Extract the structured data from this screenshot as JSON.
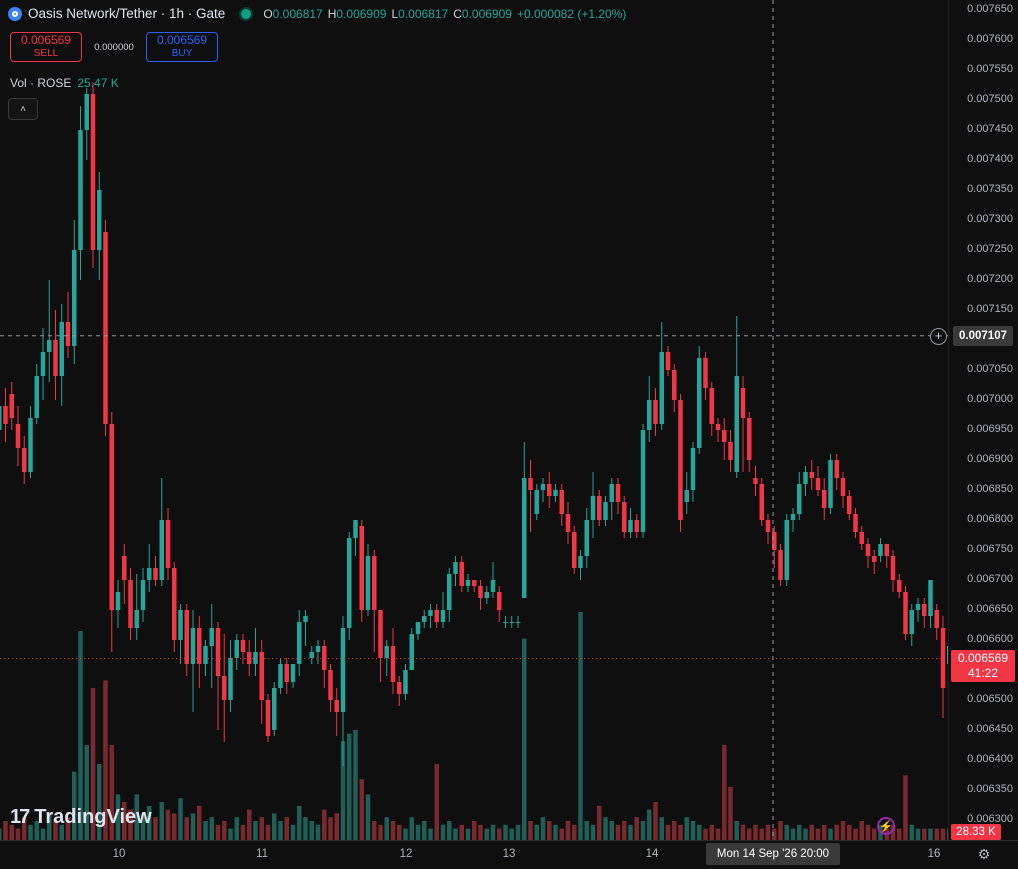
{
  "header": {
    "title": "Oasis Network/Tether · 1h · Gate",
    "ohlc": {
      "o_key": "O",
      "o": "0.006817",
      "h_key": "H",
      "h": "0.006909",
      "l_key": "L",
      "l": "0.006817",
      "c_key": "C",
      "c": "0.006909",
      "change": "+0.000082 (+1.20%)"
    }
  },
  "trade": {
    "sell_price": "0.006569",
    "sell_label": "SELL",
    "spread": "0.000000",
    "buy_price": "0.006569",
    "buy_label": "BUY"
  },
  "volume_indicator": {
    "label": "Vol · ROSE",
    "value": "25.47 K"
  },
  "branding": {
    "logo_text": "TradingView",
    "logo_mark": "17"
  },
  "price_axis": {
    "ticks": [
      "0.007650",
      "0.007600",
      "0.007550",
      "0.007500",
      "0.007450",
      "0.007400",
      "0.007350",
      "0.007300",
      "0.007250",
      "0.007200",
      "0.007150",
      "0.007100",
      "0.007050",
      "0.007000",
      "0.006950",
      "0.006900",
      "0.006850",
      "0.006800",
      "0.006750",
      "0.006700",
      "0.006650",
      "0.006600",
      "0.006550",
      "0.006500",
      "0.006450",
      "0.006400",
      "0.006350",
      "0.006300"
    ],
    "crosshair_price": "0.007107",
    "last_price": "0.006569",
    "countdown": "41:22",
    "volume_last": "28.33 K"
  },
  "time_axis": {
    "labels": [
      "10",
      "11",
      "12",
      "13",
      "14",
      "16"
    ],
    "crosshair_time": "Mon 14 Sep '26   20:00"
  },
  "colors": {
    "up": "#26a69a",
    "down": "#f23645",
    "up_vol": "#1e5f58",
    "down_vol": "#7a2a2f"
  },
  "chart_data": {
    "type": "candlestick",
    "x_labels": [
      "10",
      "11",
      "12",
      "13",
      "14",
      "16"
    ],
    "ylim": [
      0.00628,
      0.00766
    ],
    "candles": [
      [
        0.00695,
        0.00699,
        0.00693,
        0.00701
      ],
      [
        0.00699,
        0.00696,
        0.00693,
        0.00702
      ],
      [
        0.00701,
        0.00697,
        0.00695,
        0.00703
      ],
      [
        0.00696,
        0.00692,
        0.00689,
        0.00699
      ],
      [
        0.00692,
        0.00688,
        0.00686,
        0.00694
      ],
      [
        0.00688,
        0.00697,
        0.00687,
        0.00699
      ],
      [
        0.00697,
        0.00704,
        0.00696,
        0.00706
      ],
      [
        0.00704,
        0.00708,
        0.007,
        0.00712
      ],
      [
        0.00708,
        0.0071,
        0.00703,
        0.0072
      ],
      [
        0.0071,
        0.00704,
        0.007,
        0.00715
      ],
      [
        0.00704,
        0.00713,
        0.00699,
        0.00716
      ],
      [
        0.00713,
        0.00709,
        0.00707,
        0.00718
      ],
      [
        0.00709,
        0.00725,
        0.00706,
        0.0073
      ],
      [
        0.00725,
        0.00745,
        0.0072,
        0.00749
      ],
      [
        0.00745,
        0.00751,
        0.0074,
        0.00752
      ],
      [
        0.00751,
        0.00725,
        0.00722,
        0.00753
      ],
      [
        0.00725,
        0.00735,
        0.0072,
        0.00738
      ],
      [
        0.00728,
        0.00696,
        0.00694,
        0.0073
      ],
      [
        0.00696,
        0.00665,
        0.00658,
        0.00698
      ],
      [
        0.00665,
        0.00668,
        0.00662,
        0.0067
      ],
      [
        0.00674,
        0.0067,
        0.00666,
        0.00676
      ],
      [
        0.0067,
        0.00662,
        0.0066,
        0.00672
      ],
      [
        0.00662,
        0.00665,
        0.0066,
        0.00671
      ],
      [
        0.00665,
        0.0067,
        0.00663,
        0.00672
      ],
      [
        0.0067,
        0.00672,
        0.00668,
        0.00676
      ],
      [
        0.00672,
        0.0067,
        0.00669,
        0.00674
      ],
      [
        0.0067,
        0.0068,
        0.00669,
        0.00687
      ],
      [
        0.0068,
        0.00672,
        0.0067,
        0.00682
      ],
      [
        0.00672,
        0.0066,
        0.00658,
        0.00673
      ],
      [
        0.0066,
        0.00665,
        0.00656,
        0.00666
      ],
      [
        0.00665,
        0.00656,
        0.00654,
        0.00666
      ],
      [
        0.00656,
        0.00662,
        0.00648,
        0.00665
      ],
      [
        0.00662,
        0.00656,
        0.00652,
        0.00664
      ],
      [
        0.00656,
        0.00659,
        0.00654,
        0.0066
      ],
      [
        0.00659,
        0.00662,
        0.00652,
        0.00666
      ],
      [
        0.00662,
        0.00654,
        0.00645,
        0.00663
      ],
      [
        0.00654,
        0.0065,
        0.00643,
        0.00661
      ],
      [
        0.0065,
        0.00657,
        0.00648,
        0.0066
      ],
      [
        0.00657,
        0.0066,
        0.00655,
        0.00661
      ],
      [
        0.0066,
        0.00658,
        0.00656,
        0.00661
      ],
      [
        0.00658,
        0.00656,
        0.00654,
        0.0066
      ],
      [
        0.00656,
        0.00658,
        0.00654,
        0.00662
      ],
      [
        0.00658,
        0.0065,
        0.00646,
        0.0066
      ],
      [
        0.0065,
        0.00644,
        0.00643,
        0.00651
      ],
      [
        0.00645,
        0.00652,
        0.00644,
        0.00653
      ],
      [
        0.00652,
        0.00656,
        0.00651,
        0.00657
      ],
      [
        0.00656,
        0.00653,
        0.00651,
        0.00657
      ],
      [
        0.00653,
        0.00656,
        0.00652,
        0.00656
      ],
      [
        0.00656,
        0.00663,
        0.00654,
        0.00665
      ],
      [
        0.00663,
        0.00664,
        0.00659,
        0.00665
      ],
      [
        0.00657,
        0.00658,
        0.00656,
        0.00659
      ],
      [
        0.00658,
        0.00659,
        0.00656,
        0.0066
      ],
      [
        0.00659,
        0.00655,
        0.00652,
        0.0066
      ],
      [
        0.00655,
        0.0065,
        0.00648,
        0.00656
      ],
      [
        0.0065,
        0.00648,
        0.00644,
        0.00652
      ],
      [
        0.00648,
        0.00662,
        0.00639,
        0.00664
      ],
      [
        0.00662,
        0.00677,
        0.0066,
        0.00678
      ],
      [
        0.00677,
        0.0068,
        0.00674,
        0.0068
      ],
      [
        0.00679,
        0.00665,
        0.00663,
        0.0068
      ],
      [
        0.00665,
        0.00674,
        0.00664,
        0.00676
      ],
      [
        0.00674,
        0.00665,
        0.00658,
        0.00675
      ],
      [
        0.00665,
        0.00657,
        0.00653,
        0.00665
      ],
      [
        0.00657,
        0.00659,
        0.00654,
        0.0066
      ],
      [
        0.00659,
        0.00653,
        0.00651,
        0.00662
      ],
      [
        0.00653,
        0.00651,
        0.00649,
        0.00654
      ],
      [
        0.00651,
        0.00655,
        0.0065,
        0.00656
      ],
      [
        0.00655,
        0.00661,
        0.00655,
        0.00662
      ],
      [
        0.00661,
        0.00663,
        0.0066,
        0.00663
      ],
      [
        0.00663,
        0.00664,
        0.00662,
        0.00665
      ],
      [
        0.00664,
        0.00665,
        0.00662,
        0.00666
      ],
      [
        0.00665,
        0.00663,
        0.00662,
        0.00666
      ],
      [
        0.00663,
        0.00665,
        0.00662,
        0.00668
      ],
      [
        0.00665,
        0.00671,
        0.00663,
        0.00672
      ],
      [
        0.00671,
        0.00673,
        0.00669,
        0.00674
      ],
      [
        0.00673,
        0.00669,
        0.00668,
        0.00674
      ],
      [
        0.00669,
        0.0067,
        0.00668,
        0.00671
      ],
      [
        0.0067,
        0.00669,
        0.00668,
        0.0067
      ],
      [
        0.00669,
        0.00667,
        0.00665,
        0.0067
      ],
      [
        0.00667,
        0.00668,
        0.00666,
        0.00669
      ],
      [
        0.00668,
        0.0067,
        0.00667,
        0.00673
      ],
      [
        0.00668,
        0.00665,
        0.00663,
        0.00669
      ],
      [
        0.00663,
        0.00663,
        0.00662,
        0.00664
      ],
      [
        0.00663,
        0.00663,
        0.00662,
        0.00664
      ],
      [
        0.00663,
        0.00663,
        0.00662,
        0.00664
      ],
      [
        0.00667,
        0.00687,
        0.00667,
        0.00693
      ],
      [
        0.00687,
        0.00685,
        0.00678,
        0.0069
      ],
      [
        0.00681,
        0.00685,
        0.0068,
        0.00686
      ],
      [
        0.00685,
        0.00686,
        0.00683,
        0.00687
      ],
      [
        0.00686,
        0.00684,
        0.00682,
        0.00688
      ],
      [
        0.00684,
        0.00685,
        0.00683,
        0.00686
      ],
      [
        0.00685,
        0.00681,
        0.00679,
        0.00686
      ],
      [
        0.00681,
        0.00678,
        0.00676,
        0.00683
      ],
      [
        0.00678,
        0.00672,
        0.00671,
        0.00679
      ],
      [
        0.00672,
        0.00674,
        0.0067,
        0.00675
      ],
      [
        0.00674,
        0.0068,
        0.00672,
        0.00682
      ],
      [
        0.0068,
        0.00684,
        0.00677,
        0.00688
      ],
      [
        0.00684,
        0.0068,
        0.00679,
        0.00685
      ],
      [
        0.0068,
        0.00683,
        0.00679,
        0.00684
      ],
      [
        0.00683,
        0.00686,
        0.0068,
        0.00687
      ],
      [
        0.00686,
        0.00683,
        0.00681,
        0.00687
      ],
      [
        0.00683,
        0.00678,
        0.00677,
        0.00684
      ],
      [
        0.00678,
        0.0068,
        0.00677,
        0.00682
      ],
      [
        0.0068,
        0.00678,
        0.00677,
        0.00681
      ],
      [
        0.00678,
        0.00695,
        0.00677,
        0.00696
      ],
      [
        0.00695,
        0.007,
        0.00693,
        0.00704
      ],
      [
        0.007,
        0.00696,
        0.00694,
        0.00702
      ],
      [
        0.00696,
        0.00708,
        0.00695,
        0.00713
      ],
      [
        0.00708,
        0.00705,
        0.00704,
        0.00709
      ],
      [
        0.00705,
        0.007,
        0.00698,
        0.00706
      ],
      [
        0.007,
        0.0068,
        0.00678,
        0.00701
      ],
      [
        0.00683,
        0.00685,
        0.00681,
        0.00688
      ],
      [
        0.00685,
        0.00692,
        0.00683,
        0.00693
      ],
      [
        0.00692,
        0.00707,
        0.00691,
        0.00709
      ],
      [
        0.00707,
        0.00702,
        0.007,
        0.00708
      ],
      [
        0.00702,
        0.00696,
        0.00694,
        0.00703
      ],
      [
        0.00696,
        0.00695,
        0.00693,
        0.00697
      ],
      [
        0.00695,
        0.00693,
        0.0069,
        0.00697
      ],
      [
        0.00693,
        0.0069,
        0.00688,
        0.00695
      ],
      [
        0.00688,
        0.00704,
        0.00687,
        0.00714
      ],
      [
        0.00702,
        0.00697,
        0.00688,
        0.00704
      ],
      [
        0.00697,
        0.0069,
        0.00688,
        0.00698
      ],
      [
        0.00687,
        0.00686,
        0.00684,
        0.00689
      ],
      [
        0.00686,
        0.0068,
        0.00679,
        0.00687
      ],
      [
        0.0068,
        0.00678,
        0.00676,
        0.00681
      ],
      [
        0.00678,
        0.00675,
        0.00672,
        0.00679
      ],
      [
        0.00675,
        0.0067,
        0.00669,
        0.00676
      ],
      [
        0.0067,
        0.0068,
        0.00669,
        0.00681
      ],
      [
        0.0068,
        0.00681,
        0.00678,
        0.00682
      ],
      [
        0.00681,
        0.00686,
        0.0068,
        0.00688
      ],
      [
        0.00686,
        0.00688,
        0.00684,
        0.00689
      ],
      [
        0.00688,
        0.00687,
        0.00685,
        0.0069
      ],
      [
        0.00687,
        0.00685,
        0.00684,
        0.00689
      ],
      [
        0.00685,
        0.00682,
        0.0068,
        0.00687
      ],
      [
        0.00682,
        0.0069,
        0.00681,
        0.00691
      ],
      [
        0.0069,
        0.00687,
        0.00685,
        0.00691
      ],
      [
        0.00687,
        0.00684,
        0.00682,
        0.00688
      ],
      [
        0.00684,
        0.00681,
        0.0068,
        0.00685
      ],
      [
        0.00681,
        0.00678,
        0.00677,
        0.00682
      ],
      [
        0.00678,
        0.00676,
        0.00675,
        0.00679
      ],
      [
        0.00676,
        0.00674,
        0.00672,
        0.00677
      ],
      [
        0.00674,
        0.00673,
        0.00671,
        0.00675
      ],
      [
        0.00674,
        0.00676,
        0.00673,
        0.00677
      ],
      [
        0.00676,
        0.00674,
        0.00672,
        0.00676
      ],
      [
        0.00674,
        0.0067,
        0.00668,
        0.00675
      ],
      [
        0.0067,
        0.00668,
        0.00667,
        0.00671
      ],
      [
        0.00668,
        0.00661,
        0.0066,
        0.00669
      ],
      [
        0.00661,
        0.00665,
        0.00659,
        0.00666
      ],
      [
        0.00665,
        0.00666,
        0.00663,
        0.00667
      ],
      [
        0.00666,
        0.00664,
        0.00662,
        0.00667
      ],
      [
        0.00664,
        0.0067,
        0.00662,
        0.0067
      ],
      [
        0.00665,
        0.00662,
        0.0066,
        0.00666
      ],
      [
        0.00662,
        0.00652,
        0.00647,
        0.00664
      ],
      [
        0.00656,
        0.00659,
        0.00655,
        0.0066
      ],
      [
        0.00659,
        0.00657,
        0.00656,
        0.0066
      ]
    ],
    "volumes": [
      0.3,
      0.5,
      0.4,
      0.3,
      0.6,
      0.4,
      0.5,
      0.3,
      0.7,
      0.5,
      0.4,
      0.6,
      1.8,
      5.5,
      2.5,
      4.0,
      2.0,
      4.2,
      2.5,
      1.2,
      1.0,
      0.8,
      1.2,
      0.7,
      0.9,
      0.6,
      1.0,
      0.8,
      0.7,
      1.1,
      0.6,
      0.7,
      0.9,
      0.5,
      0.6,
      0.4,
      0.5,
      0.3,
      0.6,
      0.4,
      0.8,
      0.5,
      0.6,
      0.4,
      0.7,
      0.5,
      0.6,
      0.4,
      0.9,
      0.6,
      0.5,
      0.4,
      0.8,
      0.6,
      0.7,
      2.6,
      2.8,
      2.9,
      1.6,
      1.2,
      0.5,
      0.4,
      0.6,
      0.5,
      0.4,
      0.3,
      0.6,
      0.4,
      0.5,
      0.3,
      2.0,
      0.4,
      0.5,
      0.3,
      0.4,
      0.3,
      0.5,
      0.4,
      0.3,
      0.4,
      0.3,
      0.4,
      0.3,
      0.4,
      5.3,
      0.5,
      0.4,
      0.6,
      0.5,
      0.4,
      0.3,
      0.5,
      0.4,
      6.0,
      0.5,
      0.4,
      0.9,
      0.6,
      0.5,
      0.4,
      0.5,
      0.4,
      0.6,
      0.5,
      0.8,
      1.0,
      0.6,
      0.4,
      0.5,
      0.4,
      0.6,
      0.5,
      0.4,
      0.3,
      0.4,
      0.3,
      2.5,
      1.4,
      0.5,
      0.4,
      0.3,
      0.4,
      0.3,
      0.4,
      0.3,
      0.5,
      0.4,
      0.3,
      0.4,
      0.3,
      0.4,
      0.3,
      0.4,
      0.3,
      0.4,
      0.5,
      0.4,
      0.3,
      0.5,
      0.4,
      0.3,
      0.4,
      0.3,
      0.4,
      0.3,
      1.7,
      0.4
    ]
  }
}
